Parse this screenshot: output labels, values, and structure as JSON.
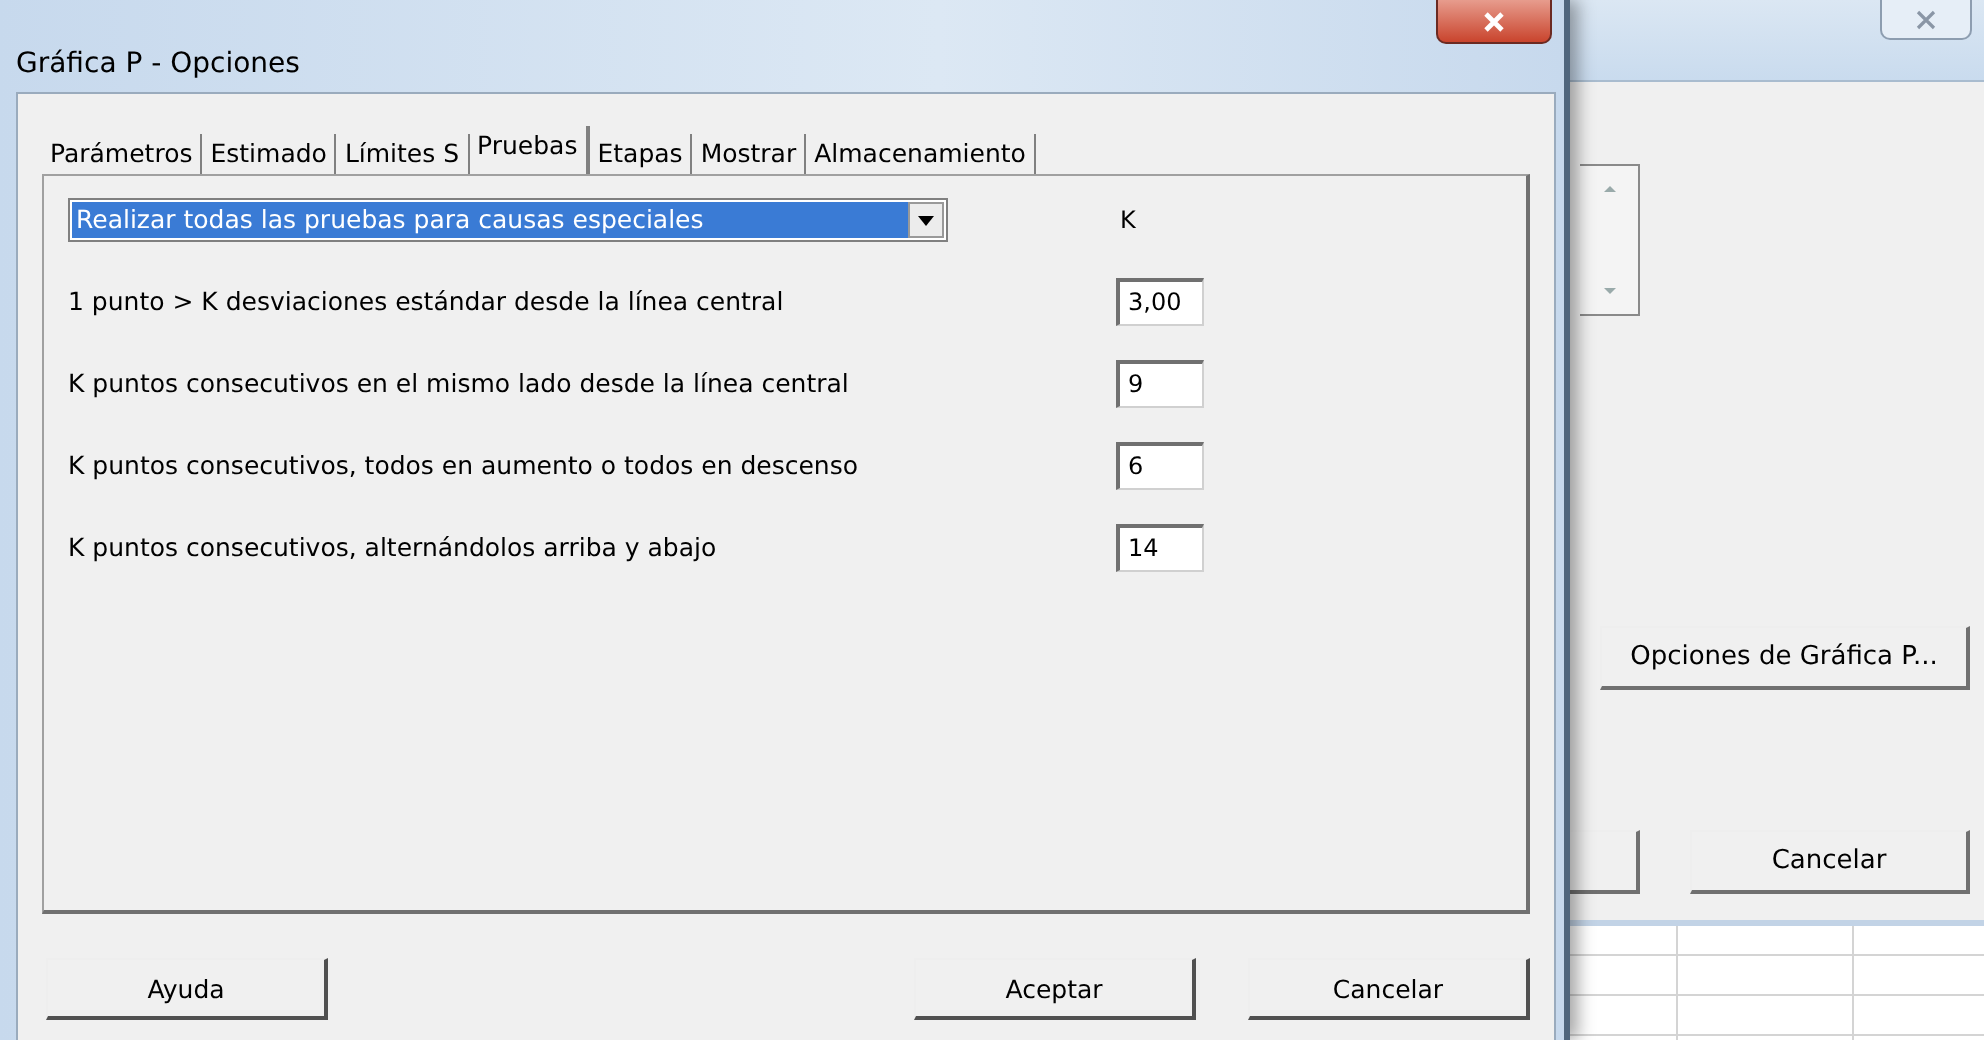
{
  "dialog": {
    "title": "Gráfica P - Opciones",
    "tabs": [
      {
        "label": "Parámetros",
        "selected": false
      },
      {
        "label": "Estimado",
        "selected": false
      },
      {
        "label": "Límites S",
        "selected": false
      },
      {
        "label": "Pruebas",
        "selected": true
      },
      {
        "label": "Etapas",
        "selected": false
      },
      {
        "label": "Mostrar",
        "selected": false
      },
      {
        "label": "Almacenamiento",
        "selected": false
      }
    ],
    "test_mode": {
      "value": "Realizar todas las pruebas para causas especiales"
    },
    "k_header": "K",
    "tests": [
      {
        "label": "1 punto > K desviaciones estándar desde la línea central",
        "value": "3,00"
      },
      {
        "label": "K puntos consecutivos en el mismo lado desde la línea central",
        "value": "9"
      },
      {
        "label": "K puntos consecutivos, todos en aumento o todos en descenso",
        "value": "6"
      },
      {
        "label": "K puntos consecutivos, alternándolos arriba y abajo",
        "value": "14"
      }
    ],
    "buttons": {
      "help": "Ayuda",
      "ok": "Aceptar",
      "cancel": "Cancelar"
    }
  },
  "background_window": {
    "options_button": "Opciones de Gráfica P...",
    "cancel_button": "Cancelar"
  }
}
